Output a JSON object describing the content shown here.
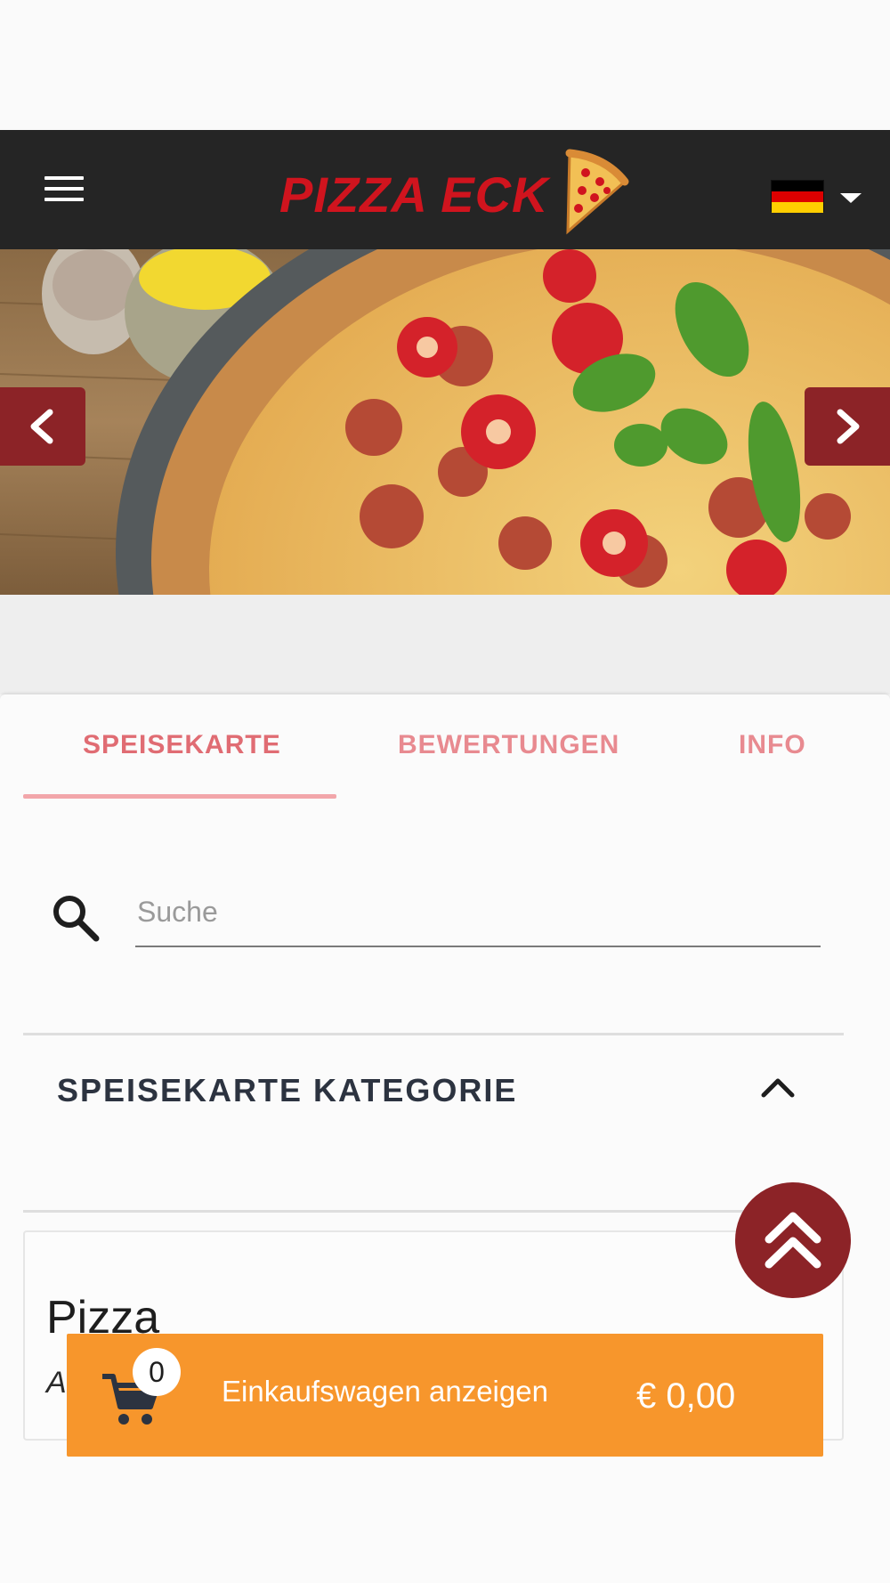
{
  "header": {
    "logo_text": "PIZZA ECK",
    "language": "de"
  },
  "hero": {
    "image": "pizza-banner"
  },
  "tabs": [
    {
      "label": "SPEISEKARTE",
      "active": true
    },
    {
      "label": "BEWERTUNGEN",
      "active": false
    },
    {
      "label": "INFO",
      "active": false
    }
  ],
  "search": {
    "placeholder": "Suche",
    "value": ""
  },
  "category": {
    "title": "SPEISEKARTE KATEGORIE",
    "expanded": true
  },
  "section": {
    "title": "Pizza",
    "subtitle_visible": "A"
  },
  "cart": {
    "count": "0",
    "label": "Einkaufswagen anzeigen",
    "total": "€ 0,00"
  },
  "colors": {
    "navbar": "#252525",
    "brand_red": "#d0141e",
    "accent_maroon": "#8c2327",
    "tab_pink": "#e06c73",
    "cart_orange": "#f7962c"
  }
}
